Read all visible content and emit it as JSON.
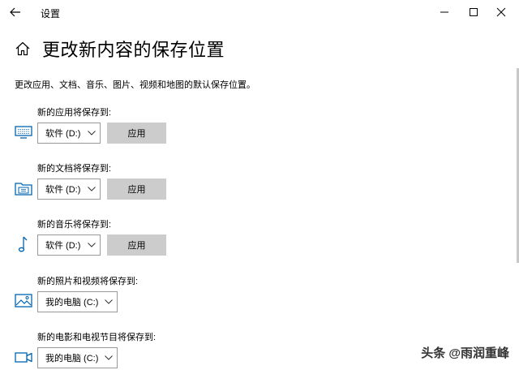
{
  "window": {
    "app_title": "设置"
  },
  "header": {
    "title": "更改新内容的保存位置"
  },
  "description": "更改应用、文档、音乐、图片、视频和地图的默认保存位置。",
  "sections": [
    {
      "label": "新的应用将保存到:",
      "icon": "monitor-icon",
      "drive": "软件 (D:)",
      "apply_label": "应用"
    },
    {
      "label": "新的文档将保存到:",
      "icon": "folder-icon",
      "drive": "软件 (D:)",
      "apply_label": "应用"
    },
    {
      "label": "新的音乐将保存到:",
      "icon": "music-note-icon",
      "drive": "软件 (D:)",
      "apply_label": "应用"
    },
    {
      "label": "新的照片和视频将保存到:",
      "icon": "picture-icon",
      "drive": "我的电脑 (C:)"
    },
    {
      "label": "新的电影和电视节目将保存到:",
      "icon": "video-camera-icon",
      "drive": "我的电脑 (C:)"
    }
  ],
  "watermark": "头条 @雨润重峰",
  "colors": {
    "accent": "#0063b1",
    "button_bg": "#cccccc",
    "border": "#999999"
  }
}
